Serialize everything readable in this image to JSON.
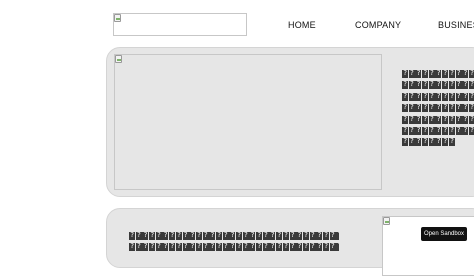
{
  "nav": {
    "links": [
      "HOME",
      "COMPANY",
      "BUSINES"
    ]
  },
  "hero_text": {
    "lines": [
      "��������������",
      "��������������",
      "��������������",
      "��������������",
      "��������������",
      "��������������",
      "��������"
    ]
  },
  "second_text": {
    "lines": [
      "����������������������������������",
      "����������������������������������"
    ]
  },
  "sandbox": {
    "label": "Open Sandbox"
  },
  "colors": {
    "panel_bg": "#e6e6e6",
    "button_bg": "#111111",
    "text": "#111111"
  },
  "icons": {
    "logo": "broken-image-icon",
    "hero_image": "broken-image-icon",
    "second_image": "broken-image-icon"
  }
}
